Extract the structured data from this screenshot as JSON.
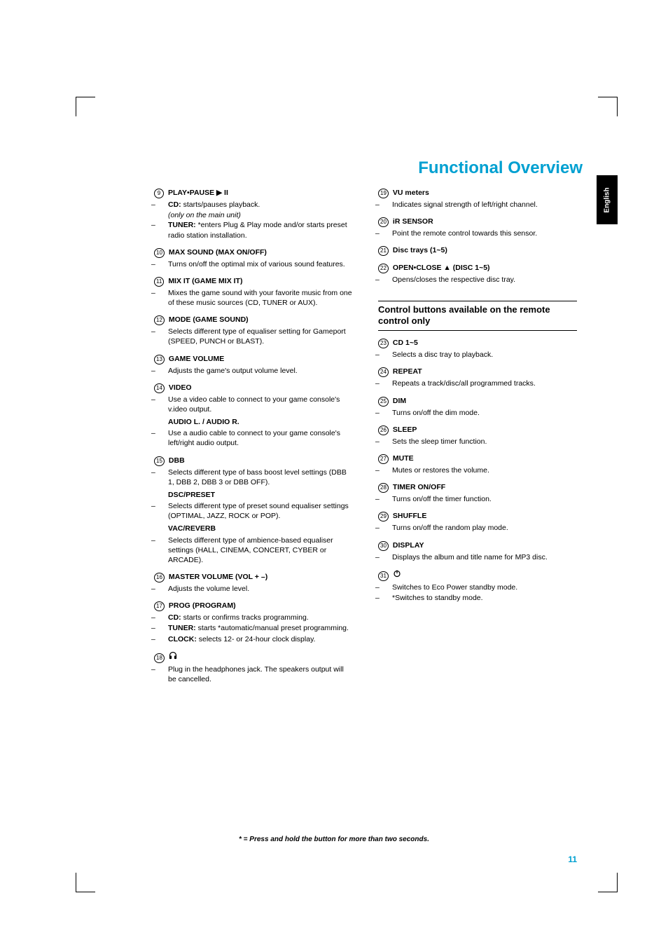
{
  "header": {
    "title": "Functional Overview",
    "lang": "English"
  },
  "footnote": "* = Press and hold the button for more than two seconds.",
  "pagenum": "11",
  "left": [
    {
      "num": "9",
      "title": "PLAY•PAUSE  ▶ II",
      "lines": [
        {
          "t": "sub",
          "html": "<b>CD:</b> starts/pauses playback."
        },
        {
          "t": "plainsub",
          "html": "<i>(only on the main unit)</i>"
        },
        {
          "t": "sub",
          "html": "<b>TUNER:</b> *enters Plug & Play mode and/or starts preset radio station installation."
        }
      ]
    },
    {
      "num": "10",
      "title": "MAX SOUND (MAX ON/OFF)",
      "lines": [
        {
          "t": "sub",
          "html": "Turns on/off the optimal mix of various sound features."
        }
      ]
    },
    {
      "num": "11",
      "title": "MIX IT (GAME MIX IT)",
      "lines": [
        {
          "t": "sub",
          "html": "Mixes the game sound with your favorite music from one of these music sources (CD, TUNER or AUX)."
        }
      ]
    },
    {
      "num": "12",
      "title": "MODE (GAME SOUND)",
      "lines": [
        {
          "t": "sub",
          "html": "Selects different type of equaliser setting for Gameport (SPEED, PUNCH or BLAST)."
        }
      ]
    },
    {
      "num": "13",
      "title": "GAME VOLUME",
      "lines": [
        {
          "t": "sub",
          "html": "Adjusts the game's output volume level."
        }
      ]
    },
    {
      "num": "14",
      "title": "VIDEO",
      "lines": [
        {
          "t": "sub",
          "html": "Use a video cable to connect to your game console's v.ideo output."
        },
        {
          "t": "subtitle",
          "html": "AUDIO L. / AUDIO R."
        },
        {
          "t": "sub",
          "html": "Use a audio cable to connect to your game console's left/right audio output."
        }
      ]
    },
    {
      "num": "15",
      "title": "DBB",
      "lines": [
        {
          "t": "sub",
          "html": "Selects different type of bass boost level settings (DBB 1, DBB 2, DBB 3 or DBB OFF)."
        },
        {
          "t": "subtitle",
          "html": "DSC/PRESET"
        },
        {
          "t": "sub",
          "html": "Selects different type of preset sound equaliser settings (OPTIMAL, JAZZ, ROCK or POP)."
        },
        {
          "t": "subtitle",
          "html": "VAC/REVERB"
        },
        {
          "t": "sub",
          "html": "Selects different type of ambience-based equaliser settings (HALL, CINEMA, CONCERT, CYBER or ARCADE)."
        }
      ]
    },
    {
      "num": "16",
      "title": "MASTER VOLUME (VOL + –)",
      "lines": [
        {
          "t": "sub",
          "html": "Adjusts the volume level."
        }
      ]
    },
    {
      "num": "17",
      "title": "PROG (PROGRAM)",
      "lines": [
        {
          "t": "sub",
          "html": "<b>CD:</b> starts or confirms tracks programming."
        },
        {
          "t": "sub",
          "html": "<b>TUNER:</b> starts *automatic/manual preset programming."
        },
        {
          "t": "sub",
          "html": "<b>CLOCK:</b> selects 12- or 24-hour clock display."
        }
      ]
    },
    {
      "num": "18",
      "titleIcon": "headphones",
      "lines": [
        {
          "t": "sub",
          "html": "Plug in the headphones jack.  The speakers output will be cancelled."
        }
      ]
    }
  ],
  "right_top": [
    {
      "num": "19",
      "title": "VU meters",
      "lines": [
        {
          "t": "sub",
          "html": "Indicates signal strength of left/right channel."
        }
      ]
    },
    {
      "num": "20",
      "title": "iR SENSOR",
      "lines": [
        {
          "t": "sub",
          "html": "Point the remote control towards this sensor."
        }
      ]
    },
    {
      "num": "21",
      "title": "Disc trays (1~5)",
      "lines": []
    },
    {
      "num": "22",
      "title": "OPEN•CLOSE ▲ (DISC 1~5)",
      "lines": [
        {
          "t": "sub",
          "html": "Opens/closes the respective disc tray."
        }
      ]
    }
  ],
  "box_title": "Control buttons available on the remote control only",
  "right_bottom": [
    {
      "num": "23",
      "title": "CD 1~5",
      "lines": [
        {
          "t": "sub",
          "html": "Selects a disc tray to playback."
        }
      ]
    },
    {
      "num": "24",
      "title": "REPEAT",
      "lines": [
        {
          "t": "sub",
          "html": "Repeats a track/disc/all programmed tracks."
        }
      ]
    },
    {
      "num": "25",
      "title": "DIM",
      "lines": [
        {
          "t": "sub",
          "html": "Turns on/off the dim mode."
        }
      ]
    },
    {
      "num": "26",
      "title": "SLEEP",
      "lines": [
        {
          "t": "sub",
          "html": "Sets the sleep timer function."
        }
      ]
    },
    {
      "num": "27",
      "title": "MUTE",
      "lines": [
        {
          "t": "sub",
          "html": "Mutes or restores the volume."
        }
      ]
    },
    {
      "num": "28",
      "title": "TIMER ON/OFF",
      "lines": [
        {
          "t": "sub",
          "html": "Turns on/off the timer function."
        }
      ]
    },
    {
      "num": "29",
      "title": "SHUFFLE",
      "lines": [
        {
          "t": "sub",
          "html": "Turns on/off the random play mode."
        }
      ]
    },
    {
      "num": "30",
      "title": "DISPLAY",
      "lines": [
        {
          "t": "sub",
          "html": "Displays the album and title name for MP3 disc."
        }
      ]
    },
    {
      "num": "31",
      "titleIcon": "power",
      "lines": [
        {
          "t": "sub",
          "html": "Switches to Eco Power standby mode."
        },
        {
          "t": "sub",
          "html": "*Switches to standby mode."
        }
      ]
    }
  ]
}
